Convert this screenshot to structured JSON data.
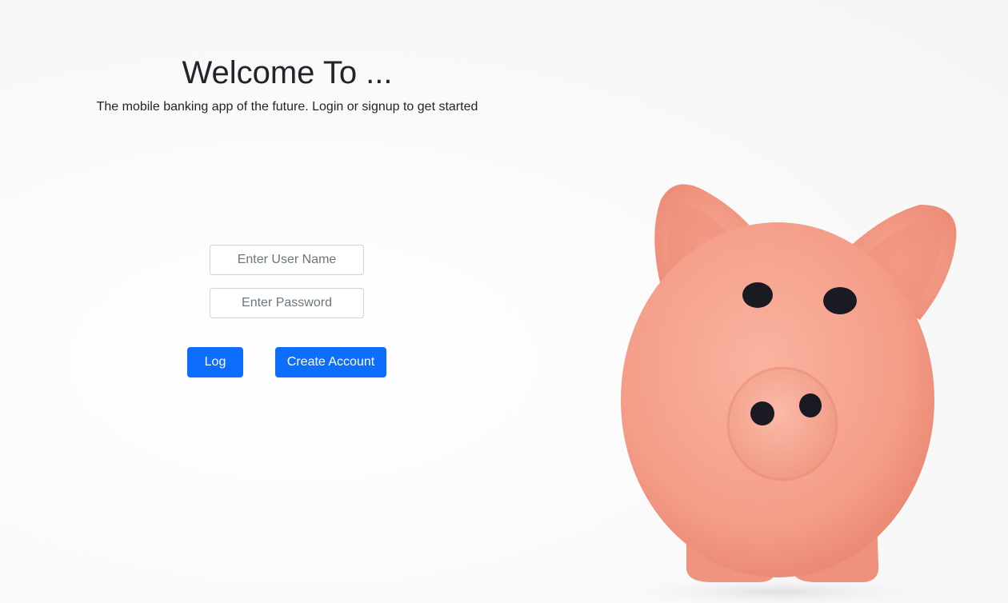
{
  "hero": {
    "title": "Welcome To ...",
    "subtitle": "The mobile banking app of the future. Login or signup to get started"
  },
  "form": {
    "username_placeholder": "Enter User Name",
    "password_placeholder": "Enter Password",
    "username_value": "",
    "password_value": ""
  },
  "actions": {
    "login_label": "Log In",
    "create_label": "Create Account"
  },
  "background": {
    "image_subject": "piggy-bank",
    "colors": {
      "pig_body": "#f4a08c",
      "pig_shadow": "#e8836f",
      "pig_eye": "#1a1a22",
      "button": "#0d6efd"
    }
  }
}
